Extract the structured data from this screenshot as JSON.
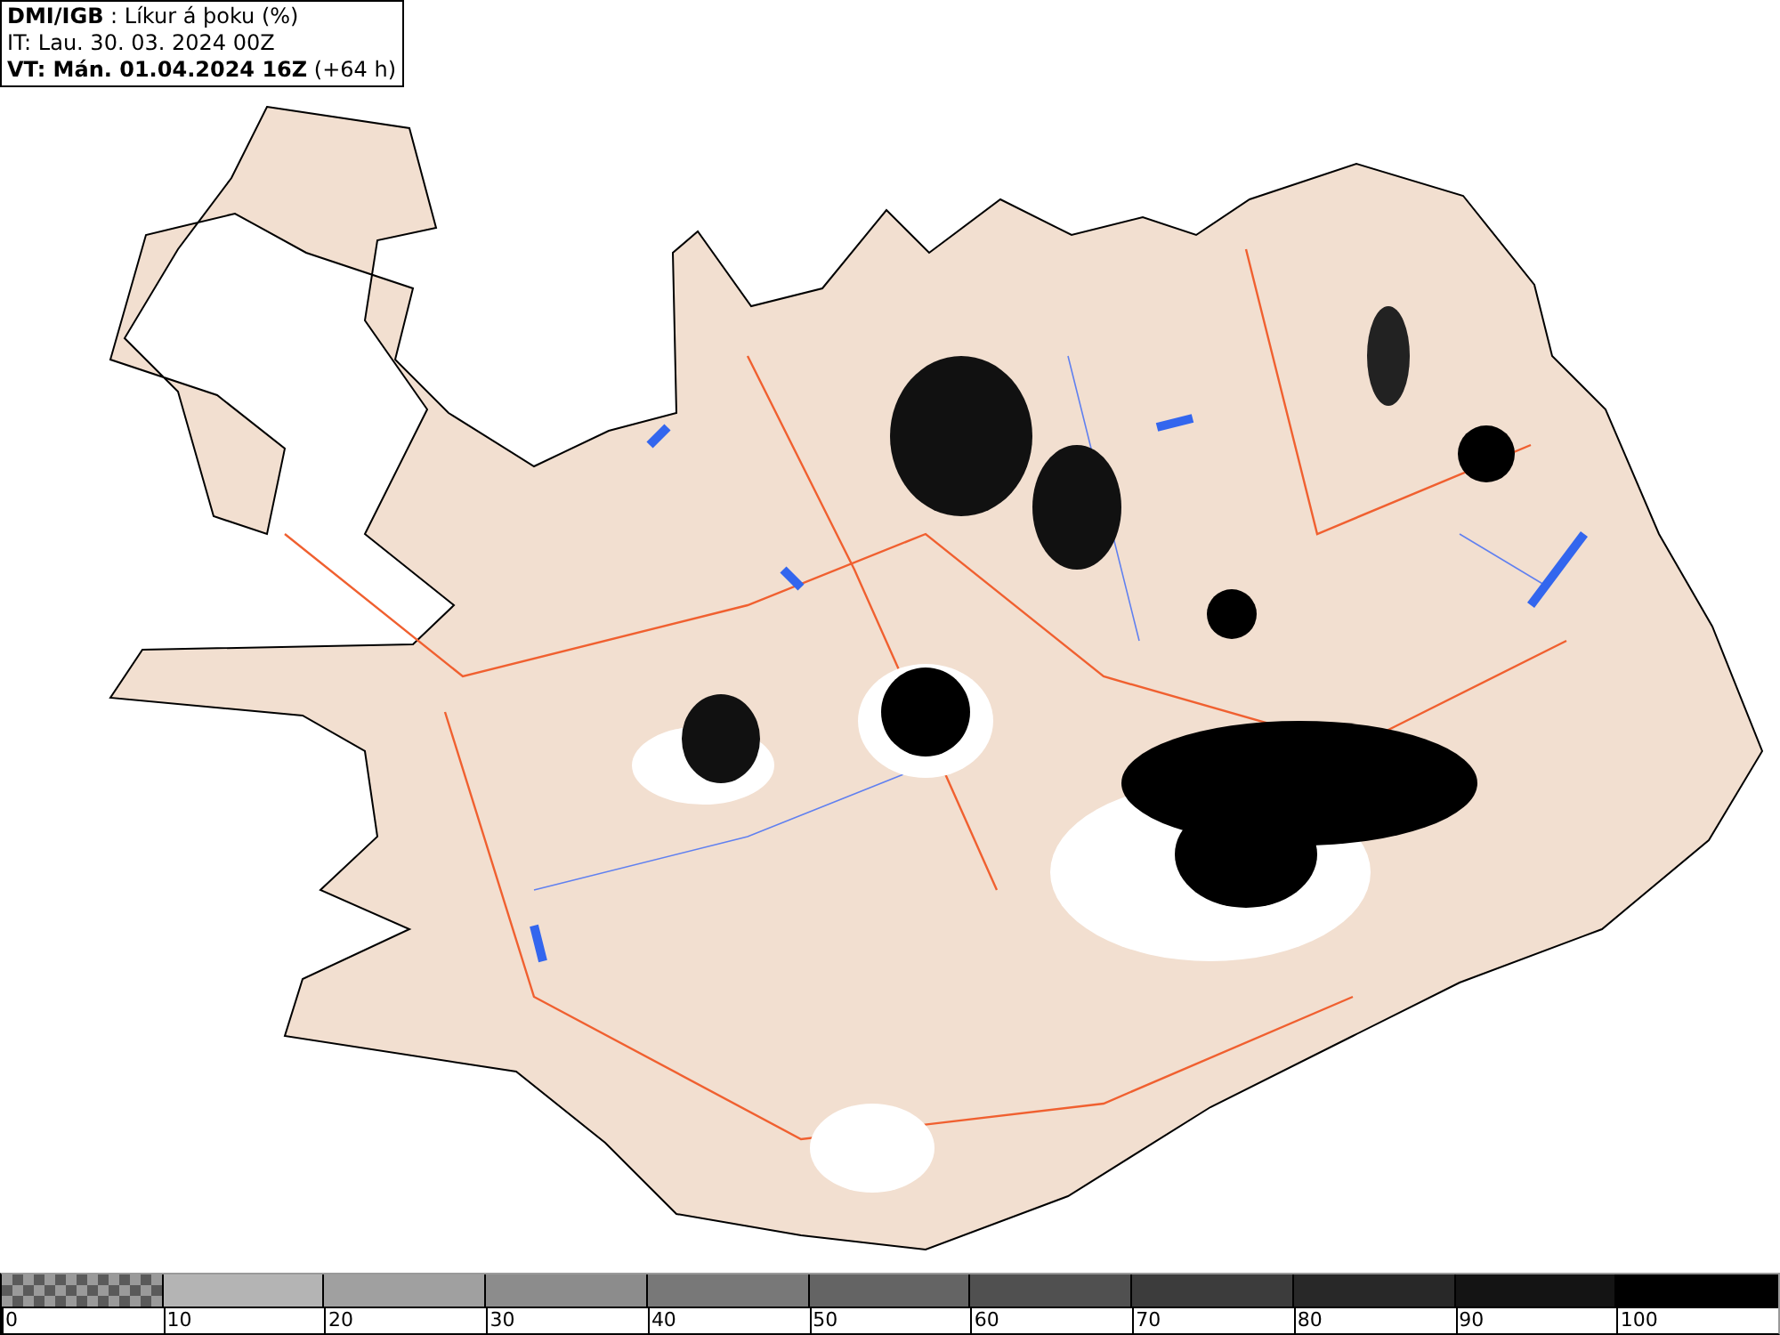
{
  "header": {
    "lines": [
      "**DMI/IGB** : Líkur á þoku (%)",
      "IT: Lau. 30. 03. 2024 00Z",
      "**VT: Mán. 01.04.2024 16Z** (+64 h)"
    ]
  },
  "legend": {
    "bins": [
      {
        "kind": "checker"
      },
      {
        "kind": "solid",
        "color": "#b4b4b4"
      },
      {
        "kind": "solid",
        "color": "#a0a0a0"
      },
      {
        "kind": "solid",
        "color": "#8c8c8c"
      },
      {
        "kind": "solid",
        "color": "#787878"
      },
      {
        "kind": "solid",
        "color": "#646464"
      },
      {
        "kind": "solid",
        "color": "#505050"
      },
      {
        "kind": "solid",
        "color": "#3c3c3c"
      },
      {
        "kind": "solid",
        "color": "#282828"
      },
      {
        "kind": "solid",
        "color": "#141414"
      },
      {
        "kind": "solid",
        "color": "#000000"
      }
    ],
    "labels": [
      "0",
      "10",
      "20",
      "30",
      "40",
      "50",
      "60",
      "70",
      "80",
      "90",
      "100"
    ]
  }
}
